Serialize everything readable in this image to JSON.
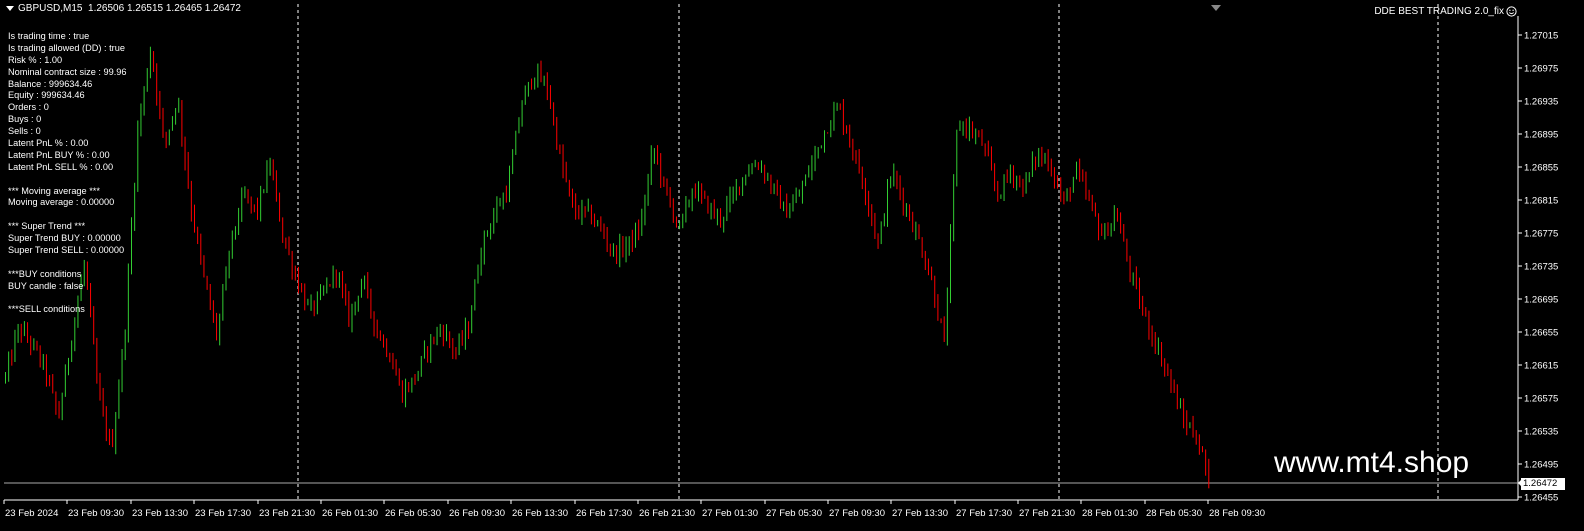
{
  "header": {
    "symbol_info": "GBPUSD,M15  1.26506 1.26515 1.26465 1.26472",
    "ea_name": "DDE BEST TRADING 2.0_fix"
  },
  "info_panel": {
    "lines": [
      "Is trading time : true",
      "Is trading allowed (DD) : true",
      "Risk % : 1.00",
      "Nominal contract size : 99.96",
      "Balance : 999634.46",
      "Equity : 999634.46",
      "Orders : 0",
      "Buys : 0",
      "Sells : 0",
      "Latent PnL % : 0.00",
      "Latent PnL BUY % : 0.00",
      "Latent PnL SELL % : 0.00",
      "",
      "*** Moving average ***",
      "Moving average : 0.00000",
      "",
      "*** Super Trend ***",
      "Super Trend BUY : 0.00000",
      "Super Trend SELL : 0.00000",
      "",
      "***BUY conditions",
      "BUY candle : false",
      "",
      "***SELL conditions"
    ]
  },
  "watermark": "www.mt4.shop",
  "current_price": "1.26472",
  "colors": {
    "background": "#000000",
    "bull": "#32CD32",
    "bear": "#FF0000",
    "grid": "#FFFFFF",
    "text": "#FFFFFF"
  },
  "chart_data": {
    "type": "candlestick",
    "symbol": "GBPUSD",
    "timeframe": "M15",
    "price_axis": {
      "ticks": [
        "1.27015",
        "1.26975",
        "1.26935",
        "1.26895",
        "1.26855",
        "1.26815",
        "1.26775",
        "1.26735",
        "1.26695",
        "1.26655",
        "1.26615",
        "1.26575",
        "1.26535",
        "1.26495",
        "1.26455"
      ],
      "range": [
        1.26455,
        1.27015
      ]
    },
    "time_axis": {
      "labels": [
        "23 Feb 2024",
        "23 Feb 09:30",
        "23 Feb 13:30",
        "23 Feb 17:30",
        "23 Feb 21:30",
        "26 Feb 01:30",
        "26 Feb 05:30",
        "26 Feb 09:30",
        "26 Feb 13:30",
        "26 Feb 17:30",
        "26 Feb 21:30",
        "27 Feb 01:30",
        "27 Feb 05:30",
        "27 Feb 09:30",
        "27 Feb 13:30",
        "27 Feb 17:30",
        "27 Feb 21:30",
        "28 Feb 01:30",
        "28 Feb 05:30",
        "28 Feb 09:30"
      ]
    },
    "close_path": [
      1.266,
      1.2666,
      1.2664,
      1.2661,
      1.2655,
      1.2665,
      1.2674,
      1.2658,
      1.2651,
      1.2665,
      1.269,
      1.27,
      1.2688,
      1.2694,
      1.2681,
      1.2672,
      1.2665,
      1.2676,
      1.2682,
      1.268,
      1.2686,
      1.2677,
      1.2672,
      1.2668,
      1.267,
      1.2673,
      1.2667,
      1.2672,
      1.2666,
      1.2663,
      1.2658,
      1.266,
      1.2664,
      1.2666,
      1.2663,
      1.2666,
      1.2676,
      1.268,
      1.2683,
      1.2693,
      1.2697,
      1.2695,
      1.2686,
      1.268,
      1.268,
      1.2678,
      1.2675,
      1.2676,
      1.2678,
      1.2688,
      1.2682,
      1.2678,
      1.2683,
      1.2681,
      1.2679,
      1.2682,
      1.2685,
      1.2686,
      1.2683,
      1.268,
      1.2682,
      1.2686,
      1.269,
      1.2693,
      1.2688,
      1.2683,
      1.2676,
      1.2685,
      1.2681,
      1.2677,
      1.2672,
      1.2664,
      1.2691,
      1.269,
      1.2688,
      1.2682,
      1.2685,
      1.2683,
      1.2687,
      1.2686,
      1.2681,
      1.2685,
      1.2681,
      1.2677,
      1.268,
      1.2673,
      1.2668,
      1.2664,
      1.266,
      1.2655,
      1.2653,
      1.2648
    ],
    "last_price": 1.26472
  }
}
